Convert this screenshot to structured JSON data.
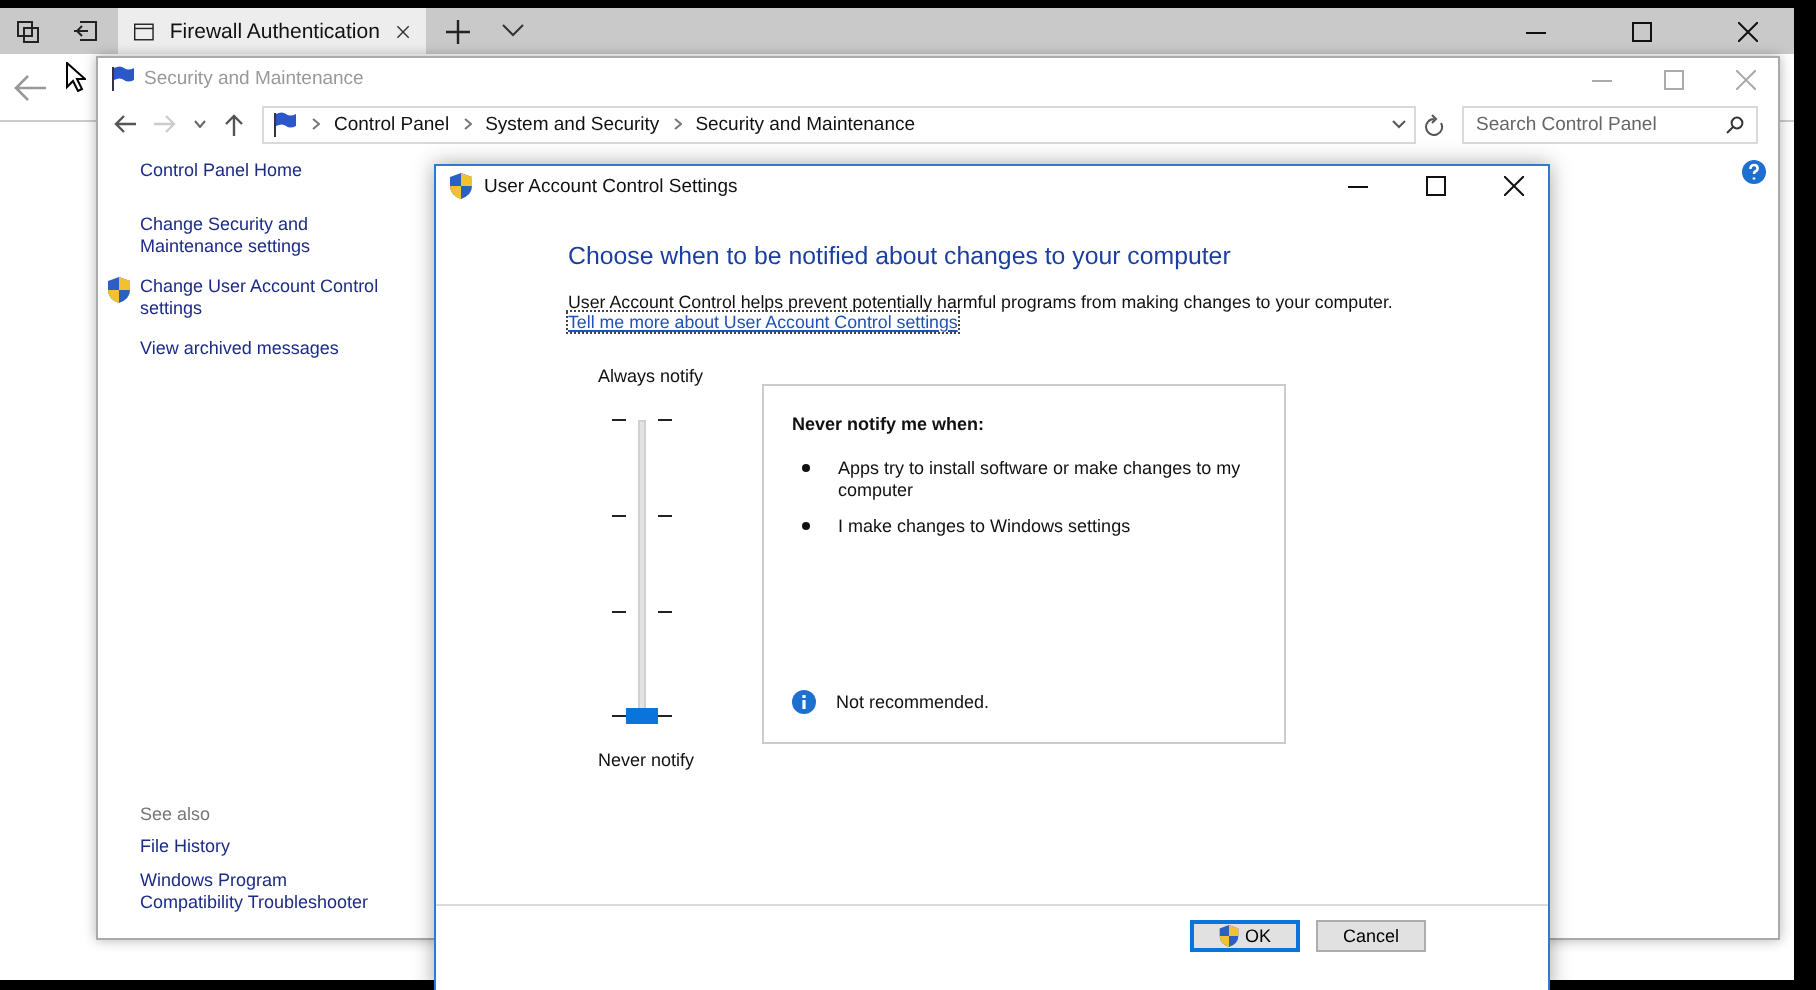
{
  "browser": {
    "tabs": [
      {
        "title": "Firewall Authentication",
        "selected": true
      }
    ]
  },
  "control_panel": {
    "title": "Security and Maintenance",
    "active": false,
    "breadcrumb": [
      "Control Panel",
      "System and Security",
      "Security and Maintenance"
    ],
    "search": {
      "placeholder": "Search Control Panel"
    },
    "sidebar": {
      "items": [
        {
          "label": "Control Panel Home",
          "kind": "link"
        },
        {
          "label": "Change Security and Maintenance settings",
          "kind": "link"
        },
        {
          "label": "Change User Account Control settings",
          "kind": "shield"
        },
        {
          "label": "View archived messages",
          "kind": "link"
        }
      ]
    },
    "see_also": {
      "heading": "See also",
      "items": [
        "File History",
        "Windows Program Compatibility Troubleshooter"
      ]
    }
  },
  "uac_dialog": {
    "title": "User Account Control Settings",
    "active": true,
    "heading": "Choose when to be notified about changes to your computer",
    "description": "User Account Control helps prevent potentially harmful programs from making changes to your computer.",
    "link": "Tell me more about User Account Control settings",
    "slider": {
      "top_label": "Always notify",
      "bottom_label": "Never notify",
      "level": 0
    },
    "info_panel": {
      "heading": "Never notify me when:",
      "bullets": [
        "Apps try to install software or make changes to my computer",
        "I make changes to Windows settings"
      ],
      "note": "Not recommended."
    },
    "buttons": [
      {
        "label": "OK",
        "kind": "default"
      },
      {
        "label": "Cancel",
        "kind": "normal"
      }
    ]
  }
}
